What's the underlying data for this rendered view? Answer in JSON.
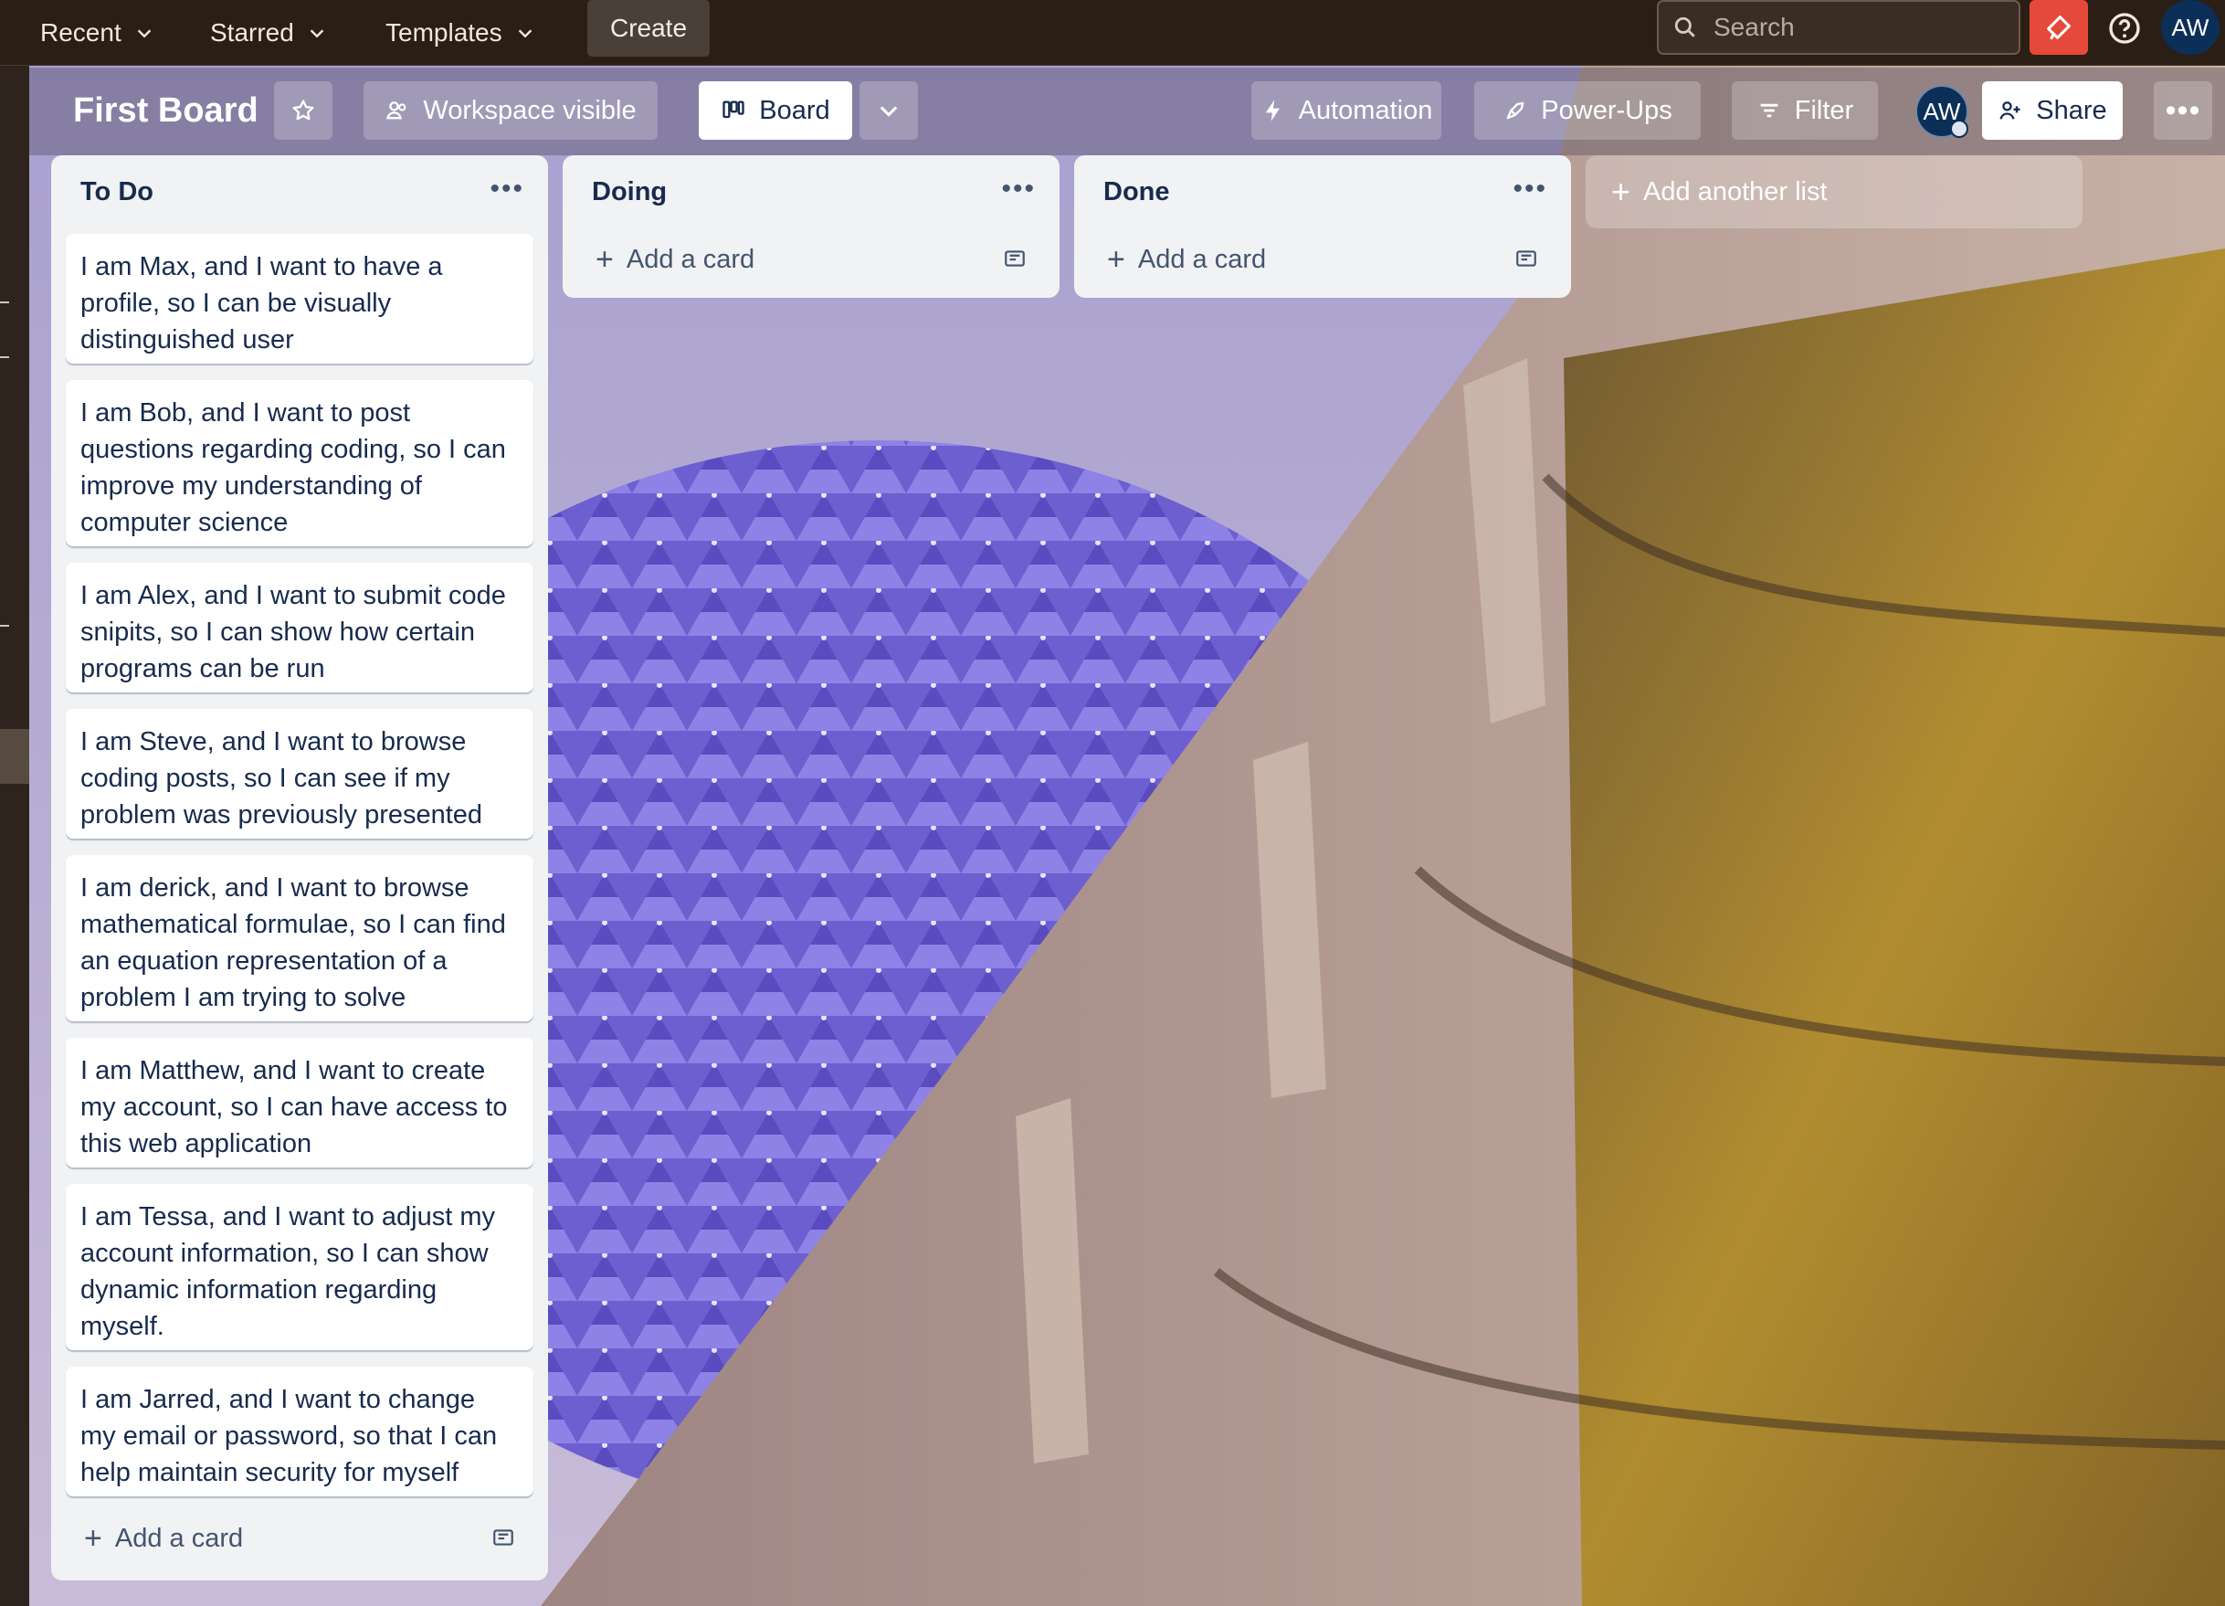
{
  "nav": {
    "recent": "Recent",
    "starred": "Starred",
    "templates": "Templates",
    "create": "Create",
    "search_placeholder": "Search",
    "avatar": "AW"
  },
  "board": {
    "title": "First Board",
    "visibility": "Workspace visible",
    "view": "Board",
    "automation": "Automation",
    "powerups": "Power-Ups",
    "filter": "Filter",
    "member_avatar": "AW",
    "share": "Share"
  },
  "lists": [
    {
      "title": "To Do",
      "cards": [
        "I am Max, and I want to have a profile, so I can be visually distinguished user",
        "I am Bob, and I want to post questions regarding coding, so I can improve my understanding of computer science",
        "I am Alex, and I want to submit code snipits, so I can show how certain programs can be run",
        "I am Steve, and I want to browse coding posts, so I can see if my problem was previously presented",
        "I am derick, and I want to browse mathematical formulae, so I can find an equation representation of a problem I am trying to solve",
        "I am Matthew, and I want to create my account, so I can have access to this web application",
        "I am Tessa, and I want to adjust my account information, so I can show dynamic information regarding myself.",
        "I am Jarred, and I want to change my email or password, so that I can help maintain security for myself"
      ],
      "add_card": "Add a card"
    },
    {
      "title": "Doing",
      "cards": [],
      "add_card": "Add a card"
    },
    {
      "title": "Done",
      "cards": [],
      "add_card": "Add a card"
    }
  ],
  "add_list": "Add another list",
  "colors": {
    "nav_bg": "#2b1e15",
    "notification": "#e5493a",
    "avatar": "#0c2f57",
    "list_bg": "#f1f2f4",
    "card_text": "#172b4d"
  }
}
